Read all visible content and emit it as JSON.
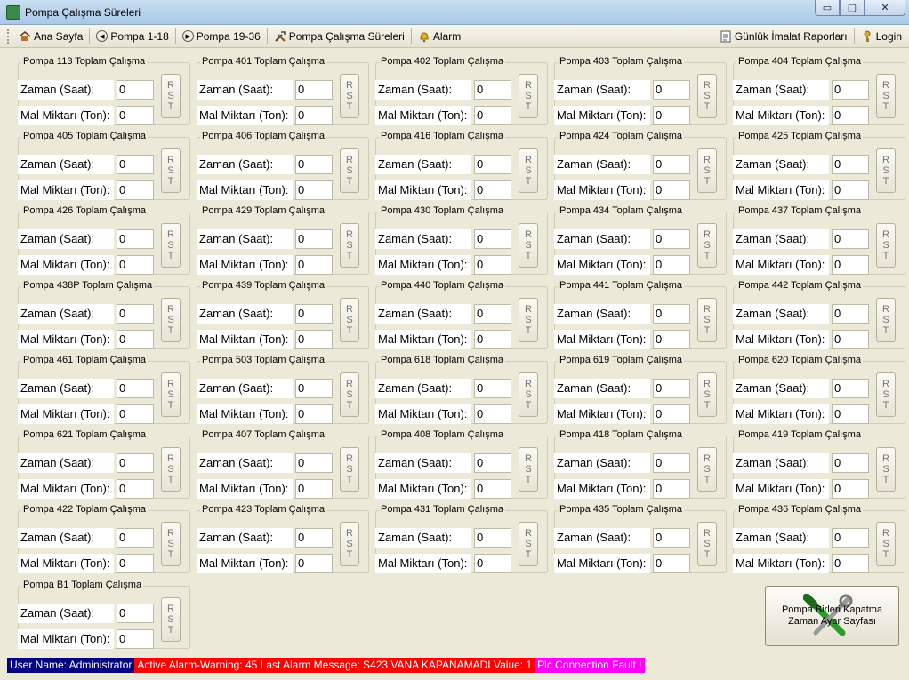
{
  "window": {
    "title": "Pompa Çalışma Süreleri",
    "minimize": "▭",
    "maximize": "▢",
    "close": "✕"
  },
  "toolbar": {
    "ana_sayfa": "Ana Sayfa",
    "pompa_1_18": "Pompa 1-18",
    "pompa_19_36": "Pompa 19-36",
    "pompa_calisma": "Pompa Çalışma Süreleri",
    "alarm": "Alarm",
    "gunluk": "Günlük İmalat Raporları",
    "login": "Login",
    "icons": {
      "home": "home-icon",
      "prev": "skip-back-icon",
      "next": "skip-forward-icon",
      "tools": "tools-icon",
      "bell": "bell-icon",
      "report": "report-icon",
      "key": "key-icon"
    }
  },
  "labels": {
    "time": "Zaman (Saat):",
    "amount": "Mal Miktarı (Ton):",
    "rst": [
      "R",
      "S",
      "T"
    ]
  },
  "panels": [
    {
      "title": "Pompa 113 Toplam Çalışma",
      "time": "0",
      "amount": "0"
    },
    {
      "title": "Pompa 401 Toplam Çalışma",
      "time": "0",
      "amount": "0"
    },
    {
      "title": "Pompa 402 Toplam Çalışma",
      "time": "0",
      "amount": "0"
    },
    {
      "title": "Pompa 403 Toplam Çalışma",
      "time": "0",
      "amount": "0"
    },
    {
      "title": "Pompa 404 Toplam Çalışma",
      "time": "0",
      "amount": "0"
    },
    {
      "title": "Pompa 405 Toplam Çalışma",
      "time": "0",
      "amount": "0"
    },
    {
      "title": "Pompa 406 Toplam Çalışma",
      "time": "0",
      "amount": "0"
    },
    {
      "title": "Pompa 416 Toplam Çalışma",
      "time": "0",
      "amount": "0"
    },
    {
      "title": "Pompa 424 Toplam Çalışma",
      "time": "0",
      "amount": "0"
    },
    {
      "title": "Pompa 425 Toplam Çalışma",
      "time": "0",
      "amount": "0"
    },
    {
      "title": "Pompa 426 Toplam Çalışma",
      "time": "0",
      "amount": "0"
    },
    {
      "title": "Pompa 429 Toplam Çalışma",
      "time": "0",
      "amount": "0"
    },
    {
      "title": "Pompa 430 Toplam Çalışma",
      "time": "0",
      "amount": "0"
    },
    {
      "title": "Pompa 434 Toplam Çalışma",
      "time": "0",
      "amount": "0"
    },
    {
      "title": "Pompa 437 Toplam Çalışma",
      "time": "0",
      "amount": "0"
    },
    {
      "title": "Pompa 438P Toplam Çalışma",
      "time": "0",
      "amount": "0"
    },
    {
      "title": "Pompa 439 Toplam Çalışma",
      "time": "0",
      "amount": "0"
    },
    {
      "title": "Pompa 440 Toplam Çalışma",
      "time": "0",
      "amount": "0"
    },
    {
      "title": "Pompa 441 Toplam Çalışma",
      "time": "0",
      "amount": "0"
    },
    {
      "title": "Pompa 442 Toplam Çalışma",
      "time": "0",
      "amount": "0"
    },
    {
      "title": "Pompa 461 Toplam Çalışma",
      "time": "0",
      "amount": "0"
    },
    {
      "title": "Pompa 503 Toplam Çalışma",
      "time": "0",
      "amount": "0"
    },
    {
      "title": "Pompa 618 Toplam Çalışma",
      "time": "0",
      "amount": "0"
    },
    {
      "title": "Pompa 619 Toplam Çalışma",
      "time": "0",
      "amount": "0"
    },
    {
      "title": "Pompa 620 Toplam Çalışma",
      "time": "0",
      "amount": "0"
    },
    {
      "title": "Pompa 621 Toplam Çalışma",
      "time": "0",
      "amount": "0"
    },
    {
      "title": "Pompa 407 Toplam Çalışma",
      "time": "0",
      "amount": "0"
    },
    {
      "title": "Pompa 408 Toplam Çalışma",
      "time": "0",
      "amount": "0"
    },
    {
      "title": "Pompa 418 Toplam Çalışma",
      "time": "0",
      "amount": "0"
    },
    {
      "title": "Pompa 419 Toplam Çalışma",
      "time": "0",
      "amount": "0"
    },
    {
      "title": "Pompa 422 Toplam Çalışma",
      "time": "0",
      "amount": "0"
    },
    {
      "title": "Pompa 423 Toplam Çalışma",
      "time": "0",
      "amount": "0"
    },
    {
      "title": "Pompa 431 Toplam Çalışma",
      "time": "0",
      "amount": "0"
    },
    {
      "title": "Pompa 435 Toplam Çalışma",
      "time": "0",
      "amount": "0"
    },
    {
      "title": "Pompa 436 Toplam Çalışma",
      "time": "0",
      "amount": "0"
    },
    {
      "title": "Pompa B1 Toplam Çalışma",
      "time": "0",
      "amount": "0"
    }
  ],
  "big_button": {
    "line1": "Pompa Birleri Kapatma",
    "line2": "Zaman Ayar Sayfası",
    "icon": "wrench-screwdriver-icon"
  },
  "status": {
    "user": "User Name: Administrator",
    "alarm": "Active Alarm-Warning: 45  Last Alarm Message: S423 VANA KAPANAMADI Value: 1",
    "plc": "Plc Connection Fault !",
    "colors": {
      "user_bg": "#000080",
      "alarm_bg": "#ff0000",
      "plc_bg": "#ff00ff",
      "text": "#ffffff"
    }
  }
}
